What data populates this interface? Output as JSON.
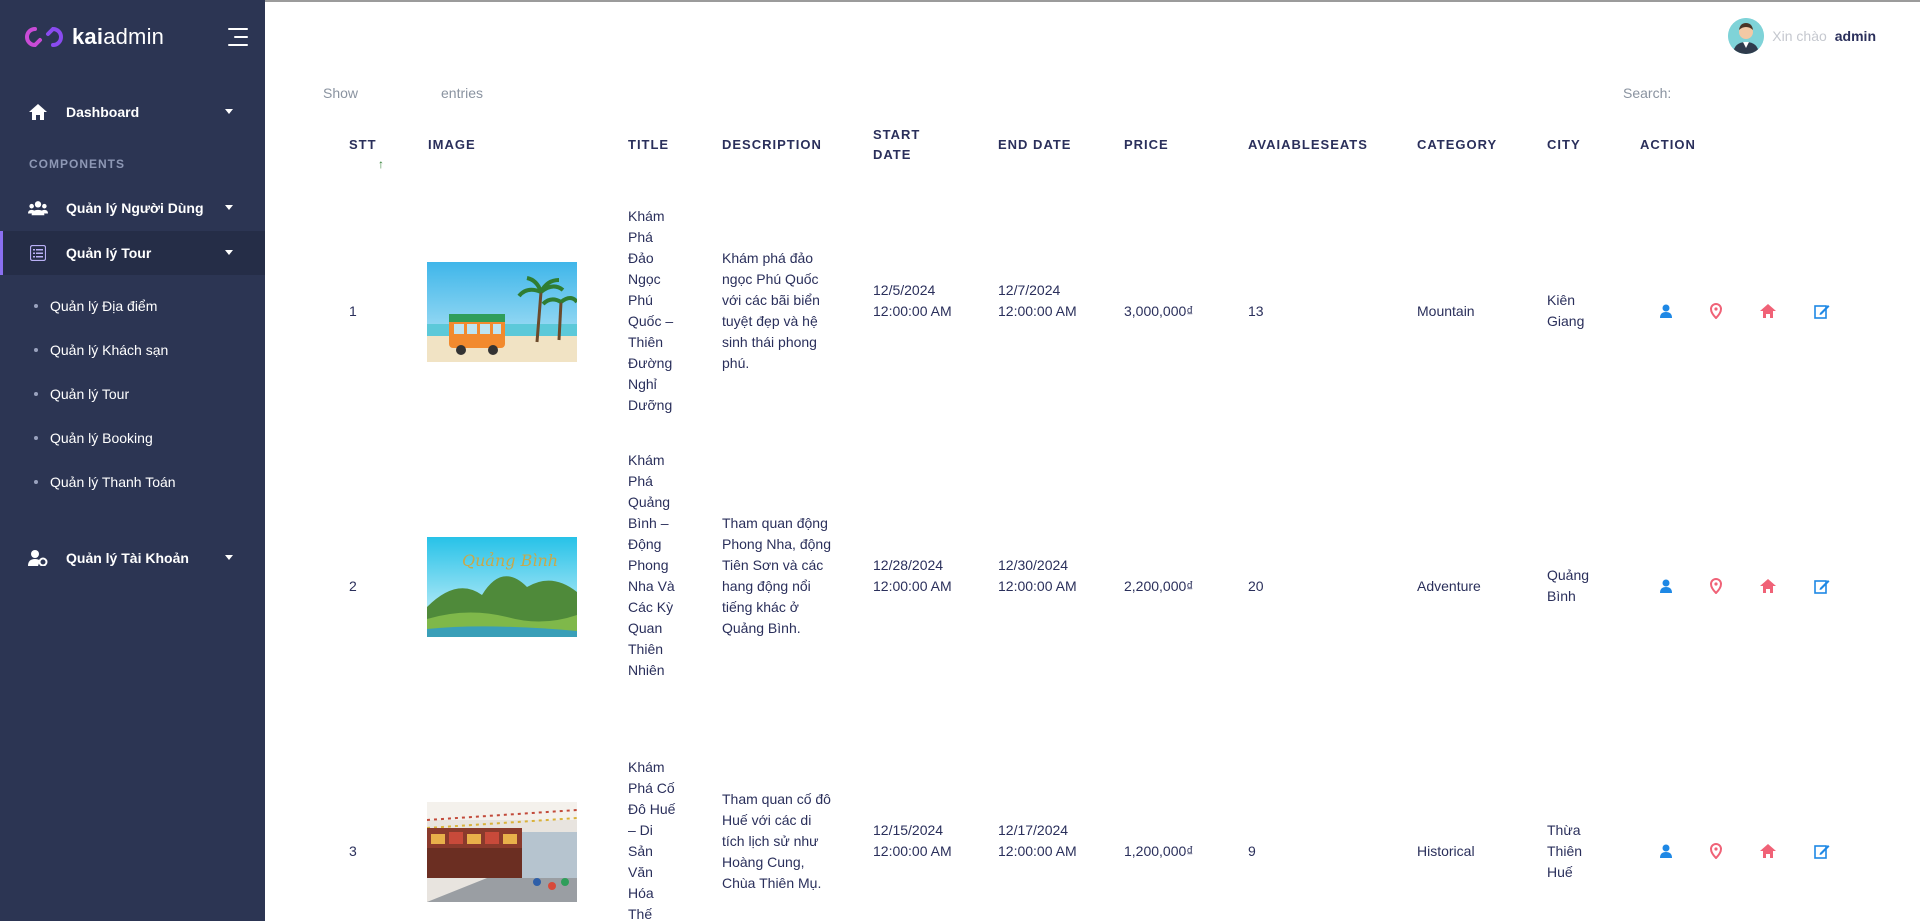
{
  "brand": {
    "name_bold": "kai",
    "name_rest": "admin"
  },
  "sidebar": {
    "dashboard": "Dashboard",
    "section": "COMPONENTS",
    "users": "Quản lý Người Dùng",
    "tour_group": "Quản lý Tour",
    "sub_items": [
      "Quản lý Địa điểm",
      "Quản lý Khách sạn",
      "Quản lý Tour",
      "Quản lý Booking",
      "Quản lý Thanh Toán"
    ],
    "accounts": "Quản lý Tài Khoản"
  },
  "header": {
    "greeting": "Xin chào",
    "user": "admin"
  },
  "table_controls": {
    "show": "Show",
    "entries": "entries",
    "search": "Search:"
  },
  "table": {
    "headers": [
      "STT",
      "IMAGE",
      "TITLE",
      "DESCRIPTION",
      "START DATE",
      "END DATE",
      "PRICE",
      "AVAIABLESEATS",
      "CATEGORY",
      "CITY",
      "ACTION"
    ],
    "rows": [
      {
        "stt": "1",
        "title": "Khám Phá Đảo Ngọc Phú Quốc – Thiên Đường Nghỉ Dưỡng",
        "description": "Khám phá đảo ngọc Phú Quốc với các bãi biển tuyệt đẹp và hệ sinh thái phong phú.",
        "start_date": "12/5/2024 12:00:00 AM",
        "end_date": "12/7/2024 12:00:00 AM",
        "price": "3,000,000₫",
        "seats": "13",
        "category": "Mountain",
        "city": "Kiên Giang"
      },
      {
        "stt": "2",
        "title": "Khám Phá Quảng Bình – Động Phong Nha Và Các Kỳ Quan Thiên Nhiên",
        "image_caption": "Quảng Bình",
        "description": "Tham quan động Phong Nha, động Tiên Sơn và các hang động nổi tiếng khác ở Quảng Bình.",
        "start_date": "12/28/2024 12:00:00 AM",
        "end_date": "12/30/2024 12:00:00 AM",
        "price": "2,200,000₫",
        "seats": "20",
        "category": "Adventure",
        "city": "Quảng Bình"
      },
      {
        "stt": "3",
        "title": "Khám Phá Cố Đô Huế – Di Sản Văn Hóa Thế",
        "description": "Tham quan cố đô Huế với các di tích lịch sử như Hoàng Cung, Chùa Thiên Mụ.",
        "start_date": "12/15/2024 12:00:00 AM",
        "end_date": "12/17/2024 12:00:00 AM",
        "price": "1,200,000₫",
        "seats": "9",
        "category": "Historical",
        "city": "Thừa Thiên Huế"
      }
    ]
  },
  "colors": {
    "sidebar_bg": "#2c3553",
    "accent_purple": "#8a6ff0",
    "action_user": "#1e88e5",
    "action_location": "#f06277",
    "action_home": "#f06277",
    "action_edit": "#1e88e5"
  },
  "icons": [
    "home-icon",
    "users-icon",
    "list-icon",
    "user-cog-icon",
    "user-icon",
    "location-icon",
    "home-action-icon",
    "edit-icon"
  ]
}
